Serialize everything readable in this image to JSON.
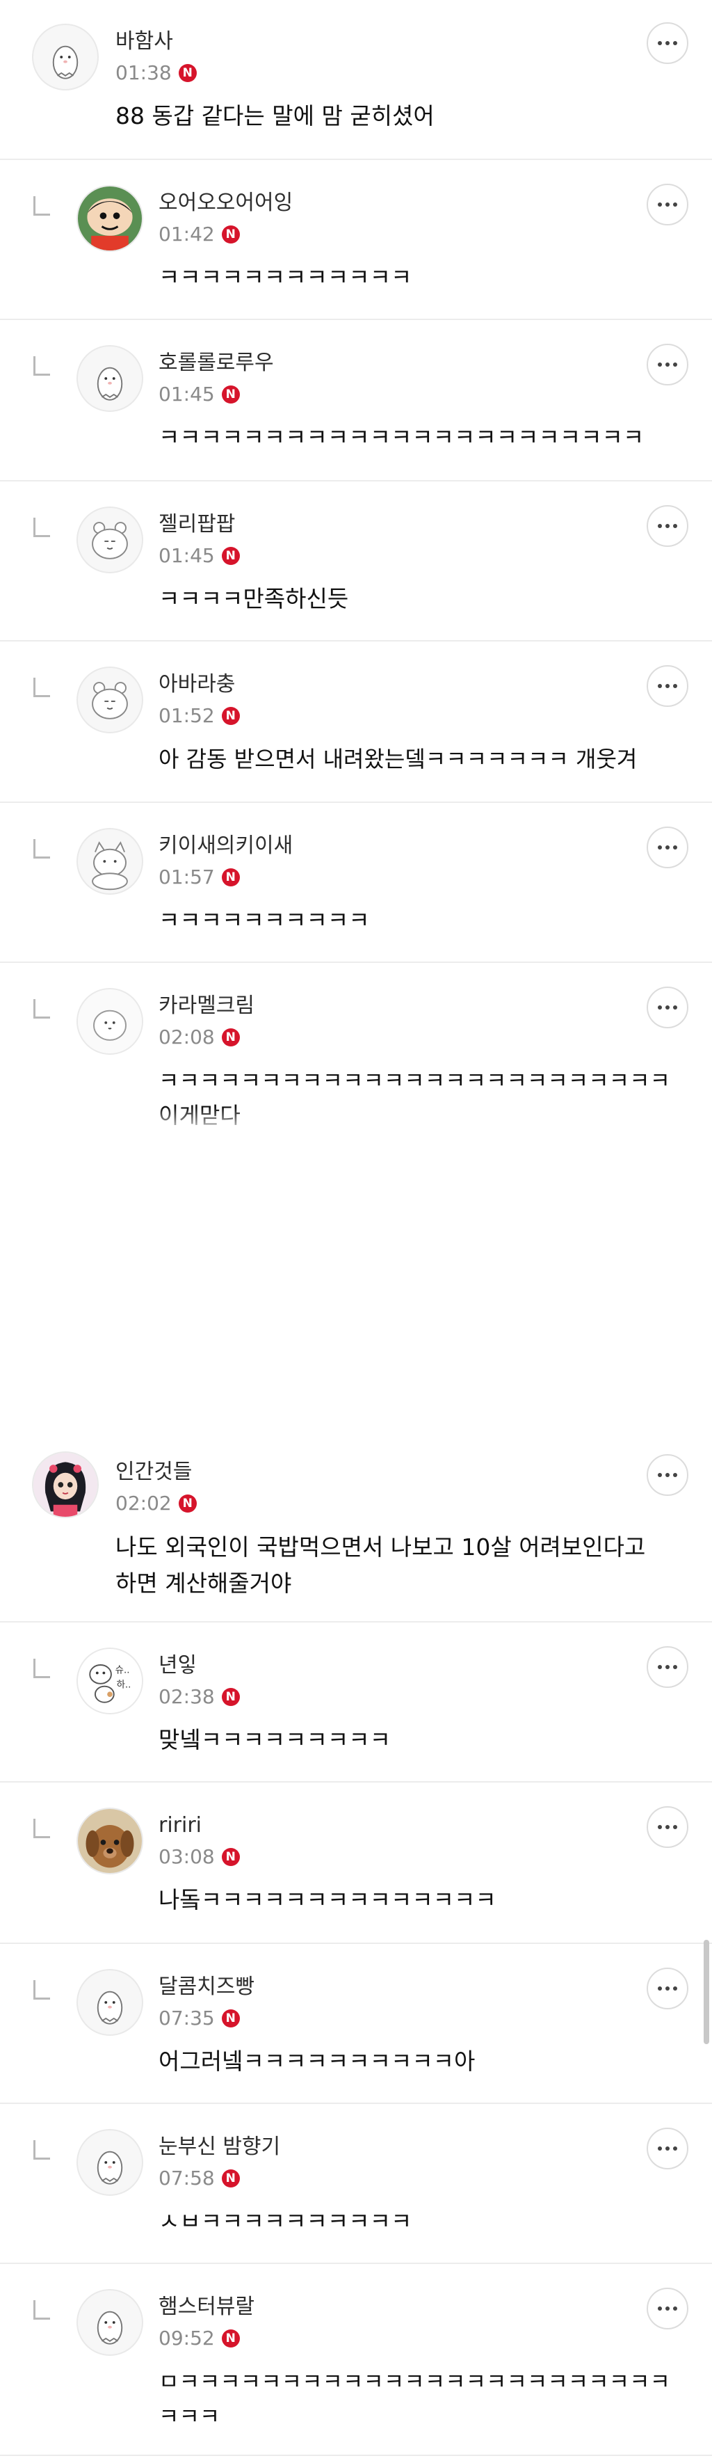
{
  "comments": [
    {
      "name": "바함사",
      "time": "01:38",
      "text": "88 동갑 같다는 말에 맘 굳히셨어",
      "avatar": "ghost-icon"
    },
    {
      "name": "오어오오어어잉",
      "time": "01:42",
      "text": "ㅋㅋㅋㅋㅋㅋㅋㅋㅋㅋㅋㅋ",
      "avatar": "cartoon-avatar"
    },
    {
      "name": "호롤롤로루우",
      "time": "01:45",
      "text": "ㅋㅋㅋㅋㅋㅋㅋㅋㅋㅋㅋㅋㅋㅋㅋㅋㅋㅋㅋㅋㅋㅋㅋ",
      "avatar": "ghost-icon"
    },
    {
      "name": "젤리팝팝",
      "time": "01:45",
      "text": "ㅋㅋㅋㅋ만족하신듯",
      "avatar": "bear-icon"
    },
    {
      "name": "아바라충",
      "time": "01:52",
      "text": "아 감동 받으면서 내려왔는뎈ㅋㅋㅋㅋㅋㅋㅋ 개웃겨",
      "avatar": "bear-icon"
    },
    {
      "name": "키이새의키이새",
      "time": "01:57",
      "text": "ㅋㅋㅋㅋㅋㅋㅋㅋㅋㅋ",
      "avatar": "cat-icon"
    },
    {
      "name": "카라멜크림",
      "time": "02:08",
      "text": "ㅋㅋㅋㅋㅋㅋㅋㅋㅋㅋㅋㅋㅋㅋㅋㅋㅋㅋㅋㅋㅋㅋㅋㅋㅋ이게맏다",
      "avatar": "blob-icon"
    },
    {
      "name": "인간것들",
      "time": "02:02",
      "text": "나도 외국인이 국밥먹으면서 나보고 10살 어려보인다고 하면 계산해줄거야",
      "avatar": "girl-avatar"
    },
    {
      "name": "년잏",
      "time": "02:38",
      "text": "맞넼ㅋㅋㅋㅋㅋㅋㅋㅋㅋ",
      "avatar": "doodle-avatar"
    },
    {
      "name": "ririri",
      "time": "03:08",
      "text": "나돜ㅋㅋㅋㅋㅋㅋㅋㅋㅋㅋㅋㅋㅋㅋ",
      "avatar": "dog-photo"
    },
    {
      "name": "달콤치즈빵",
      "time": "07:35",
      "text": "어그러넼ㅋㅋㅋㅋㅋㅋㅋㅋㅋㅋ아",
      "avatar": "ghost-icon"
    },
    {
      "name": "눈부신 밤향기",
      "time": "07:58",
      "text": "ㅅㅂㅋㅋㅋㅋㅋㅋㅋㅋㅋㅋ",
      "avatar": "ghost-icon"
    },
    {
      "name": "햄스터뷰랄",
      "time": "09:52",
      "text": "ㅁㅋㅋㅋㅋㅋㅋㅋㅋㅋㅋㅋㅋㅋㅋㅋㅋㅋㅋㅋㅋㅋㅋㅋㅋㅋㅋㅋ",
      "avatar": "ghost-icon"
    }
  ],
  "badge_label": "N",
  "colors": {
    "badge": "#d6142b",
    "divider": "#ececec",
    "time": "#8a8a8a"
  }
}
